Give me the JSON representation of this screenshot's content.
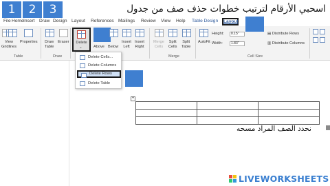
{
  "top": {
    "numbers": [
      "1",
      "2",
      "3"
    ],
    "instruction": "اسحبي الأرقام لترتيب خطوات حذف صف من جدول"
  },
  "tabs": [
    "File",
    "Home",
    "Insert",
    "Draw",
    "Design",
    "Layout",
    "References",
    "Mailings",
    "Review",
    "View",
    "Help",
    "Table Design",
    "Layout"
  ],
  "ribbon": {
    "table_group": {
      "view_gridlines": [
        "View",
        "Gridlines"
      ],
      "properties": "Properties",
      "label": "Table"
    },
    "draw_group": {
      "draw_table": [
        "Draw",
        "Table"
      ],
      "eraser": "Eraser",
      "label": "Draw"
    },
    "delete": "Delete",
    "rows_cols": {
      "insert_above": "Above",
      "insert_below": "Below",
      "insert_left": [
        "Insert",
        "Left"
      ],
      "insert_right": [
        "Insert",
        "Right"
      ]
    },
    "merge_group": {
      "merge_cells": [
        "Merge",
        "Cells"
      ],
      "split_cells": [
        "Split",
        "Cells"
      ],
      "split_table": [
        "Split",
        "Table"
      ],
      "label": "Merge"
    },
    "cell_size": {
      "autofit": "AutoFit",
      "height_label": "Height:",
      "height_value": "0.15\"",
      "width_label": "Width:",
      "width_value": "1.83\"",
      "distribute_rows": "Distribute Rows",
      "distribute_columns": "Distribute Columns",
      "label": "Cell Size"
    }
  },
  "menu": {
    "items": [
      "Delete Cells...",
      "Delete Columns",
      "Delete Rows",
      "Delete Table"
    ]
  },
  "document": {
    "caption": "نحدد الصف المراد مسحه",
    "table_rows": 3,
    "table_cols": 3
  },
  "watermark": "LIVEWORKSHEETS",
  "colors": {
    "tile_blue": "#3f7fd0",
    "selected_border": "#1a1a1a",
    "accent": "#2b579a"
  }
}
